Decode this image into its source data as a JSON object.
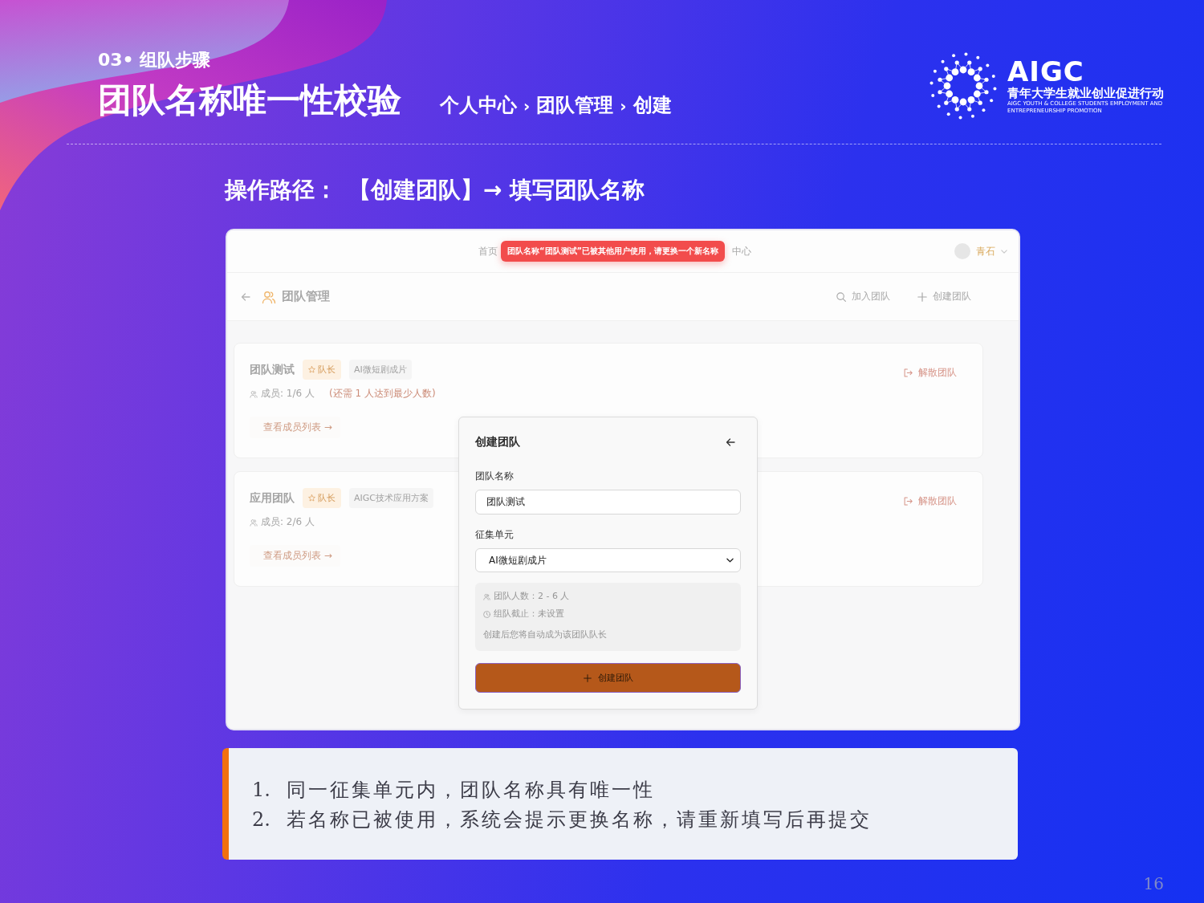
{
  "header": {
    "section": "03• 组队步骤",
    "title": "团队名称唯一性校验",
    "breadcrumb": [
      {
        "label": "个人中心"
      },
      {
        "separator": "›",
        "label": "团队管理"
      },
      {
        "separator": "›",
        "label": "创建"
      }
    ]
  },
  "logo": {
    "name": "AIGC",
    "tagline": "青年大学生就业创业促进行动",
    "english": [
      "AIGC YOUTH & COLLEGE STUDENTS EMPLOYMENT AND",
      "ENTREPRENEURSHIP PROMOTION"
    ]
  },
  "operation_path": {
    "label": "操作路径：",
    "steps": "【创建团队】→ 填写团队名称"
  },
  "screenshot": {
    "nav": {
      "items": [
        "首页",
        "中心"
      ],
      "user": "青石"
    },
    "toast": "团队名称“团队测试”已被其他用户使用，请更换一个新名称",
    "page_header": {
      "title": "团队管理",
      "actions": [
        {
          "kind": "search",
          "label": "加入团队"
        },
        {
          "kind": "add",
          "label": "创建团队"
        }
      ]
    },
    "teams": [
      {
        "name": "团队测试",
        "role": "队长",
        "unit": "AI微短剧成片",
        "members": "成员: 1/6 人",
        "note": "(还需 1 人达到最少人数)",
        "link": "查看成员列表 →",
        "action": "解散团队"
      },
      {
        "name": "应用团队",
        "role": "队长",
        "unit": "AIGC技术应用方案",
        "members": "成员: 2/6 人",
        "link": "查看成员列表 →",
        "action": "解散团队"
      }
    ],
    "modal": {
      "title": "创建团队",
      "fields": [
        {
          "kind": "input",
          "label": "团队名称",
          "value": "团队测试"
        },
        {
          "kind": "select",
          "label": "征集单元",
          "value": "AI微短剧成片"
        }
      ],
      "info": [
        {
          "kind": "people",
          "text": "团队人数：2 - 6 人"
        },
        {
          "kind": "clock",
          "text": "组队截止：未设置"
        },
        {
          "kind": "plain",
          "text": "创建后您将自动成为该团队队长"
        }
      ],
      "submit": "创建团队"
    }
  },
  "notes": [
    {
      "number": "1.",
      "text": "同一征集单元内，团队名称具有唯一性"
    },
    {
      "number": "2.",
      "text": "若名称已被使用，系统会提示更换名称，请重新填写后再提交"
    }
  ],
  "page_number": "16"
}
